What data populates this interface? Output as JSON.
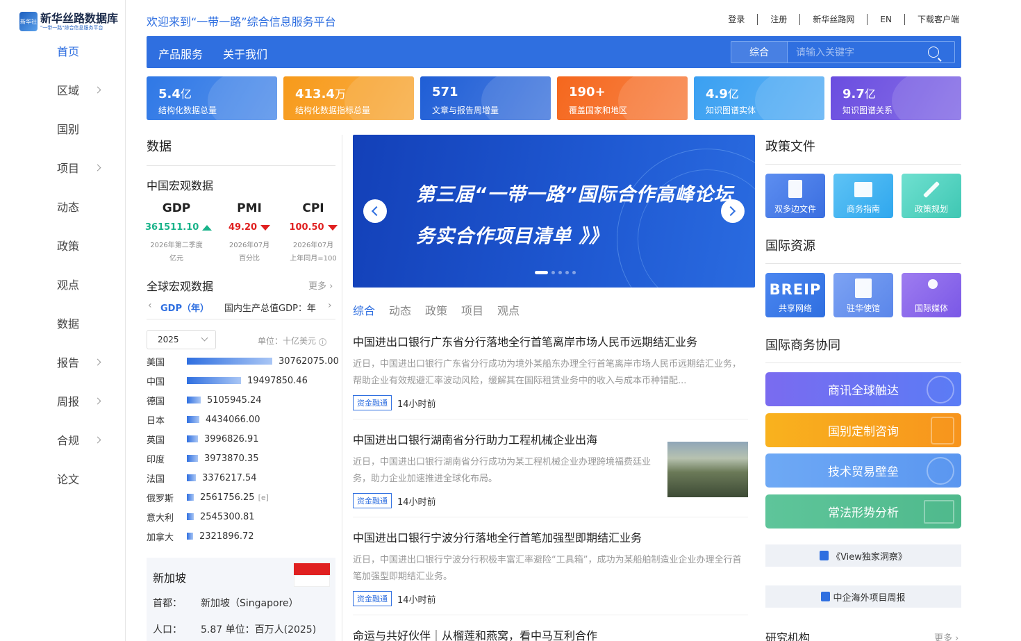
{
  "brand": {
    "title": "新华丝路数据库",
    "subtitle": "\"一带一路\"综合信息服务平台",
    "mark": "新华社"
  },
  "sidebar": {
    "items": [
      {
        "label": "首页",
        "active": true,
        "chevron": false
      },
      {
        "label": "区域",
        "chevron": true
      },
      {
        "label": "国别",
        "chevron": false
      },
      {
        "label": "项目",
        "chevron": true
      },
      {
        "label": "动态",
        "chevron": false
      },
      {
        "label": "政策",
        "chevron": false
      },
      {
        "label": "观点",
        "chevron": false
      },
      {
        "label": "数据",
        "chevron": false
      },
      {
        "label": "报告",
        "chevron": true
      },
      {
        "label": "周报",
        "chevron": true
      },
      {
        "label": "合规",
        "chevron": true
      },
      {
        "label": "论文",
        "chevron": false
      }
    ]
  },
  "header": {
    "welcome": "欢迎来到“一带一路”综合信息服务平台",
    "links": [
      "登录",
      "注册",
      "新华丝路网",
      "EN",
      "下载客户端"
    ]
  },
  "navbar": {
    "items": [
      "产品服务",
      "关于我们"
    ],
    "search_category": "综合",
    "search_placeholder": "请输入关键字"
  },
  "stats": [
    {
      "value": "5.4",
      "unit": "亿",
      "label": "结构化数据总量",
      "color": "#2f78e6"
    },
    {
      "value": "413.4",
      "unit": "万",
      "label": "结构化数据指标总量",
      "color": "#f79a1a"
    },
    {
      "value": "571",
      "unit": "",
      "label": "文章与报告周增量",
      "color": "#1f5ed6"
    },
    {
      "value": "190+",
      "unit": "",
      "label": "覆盖国家和地区",
      "color": "#f5671d"
    },
    {
      "value": "4.9",
      "unit": "亿",
      "label": "知识图谱实体",
      "color": "#3aa0f2"
    },
    {
      "value": "9.7",
      "unit": "亿",
      "label": "知识图谱关系",
      "color": "#6a4de0"
    }
  ],
  "data_section": {
    "title": "数据",
    "china_macro_title": "中国宏观数据",
    "macro": [
      {
        "name": "GDP",
        "value": "361511.10",
        "trend": "up",
        "color": "#19b38a",
        "period": "2026年第二季度",
        "unit": "亿元"
      },
      {
        "name": "PMI",
        "value": "49.20",
        "trend": "down",
        "color": "#e02020",
        "period": "2026年07月",
        "unit": "百分比"
      },
      {
        "name": "CPI",
        "value": "100.50",
        "trend": "down",
        "color": "#e02020",
        "period": "2026年07月",
        "unit": "上年同月=100"
      }
    ],
    "global_title": "全球宏观数据",
    "more": "更多",
    "indicator_tab": "GDP（年）",
    "indicator_desc": "国内生产总值GDP：年",
    "year": "2025",
    "unit_label": "单位：十亿美元",
    "countries": [
      {
        "name": "美国",
        "value": 30762075.0,
        "label": "30762075.00"
      },
      {
        "name": "中国",
        "value": 19497850.46,
        "label": "19497850.46"
      },
      {
        "name": "德国",
        "value": 5105945.24,
        "label": "5105945.24"
      },
      {
        "name": "日本",
        "value": 4434066.0,
        "label": "4434066.00"
      },
      {
        "name": "英国",
        "value": 3996826.91,
        "label": "3996826.91"
      },
      {
        "name": "印度",
        "value": 3973870.35,
        "label": "3973870.35"
      },
      {
        "name": "法国",
        "value": 3376217.54,
        "label": "3376217.54"
      },
      {
        "name": "俄罗斯",
        "value": 2561756.25,
        "label": "2561756.25",
        "note": "[e]"
      },
      {
        "name": "意大利",
        "value": 2545300.81,
        "label": "2545300.81"
      },
      {
        "name": "加拿大",
        "value": 2321896.72,
        "label": "2321896.72"
      }
    ],
    "country_card": {
      "name": "新加坡",
      "capital_label": "首都：",
      "capital": "新加坡（Singapore）",
      "pop_label": "人口：",
      "pop": "5.87 单位：百万人(2025)"
    }
  },
  "banner": {
    "line1": "第三届“一带一路”国际合作高峰论坛",
    "line2": "务实合作项目清单 》》"
  },
  "content_tabs": [
    "综合",
    "动态",
    "政策",
    "项目",
    "观点"
  ],
  "news": [
    {
      "title": "中国进出口银行广东省分行落地全行首笔离岸市场人民币远期结汇业务",
      "body": "近日，中国进出口银行广东省分行成功为境外某船东办理全行首笔离岸市场人民币远期结汇业务，帮助企业有效规避汇率波动风险，缓解其在国际租赁业务中的收入与成本币种错配...",
      "tag": "资金融通",
      "time": "14小时前"
    },
    {
      "title": "中国进出口银行湖南省分行助力工程机械企业出海",
      "body": "近日，中国进出口银行湖南省分行成功为某工程机械企业办理跨境福费廷业务，助力企业加速推进全球化布局。",
      "tag": "资金融通",
      "time": "14小时前"
    },
    {
      "title": "中国进出口银行宁波分行落地全行首笔加强型即期结汇业务",
      "body": "近日，中国进出口银行宁波分行积极丰富汇率避险“工具箱”，成功为某船舶制造业企业办理全行首笔加强型即期结汇业务。",
      "tag": "资金融通",
      "time": "14小时前"
    },
    {
      "title": "命运与共好伙伴｜从榴莲和燕窝，看中马互利合作"
    }
  ],
  "right": {
    "policy_title": "政策文件",
    "policy_tiles": [
      "双多边文件",
      "商务指南",
      "政策规划"
    ],
    "resource_title": "国际资源",
    "resource_tiles": [
      {
        "big": "BREIP",
        "label": "共享网络"
      },
      {
        "label": "驻华使馆"
      },
      {
        "label": "国际媒体"
      }
    ],
    "biz_title": "国际商务协同",
    "biz_buttons": [
      "商讯全球触达",
      "国别定制咨询",
      "技术贸易壁垒",
      "常法形势分析"
    ],
    "grey_buttons": [
      "《View独家洞察》",
      "中企海外项目周报"
    ],
    "research_title": "研究机构",
    "research_more": "更多"
  }
}
